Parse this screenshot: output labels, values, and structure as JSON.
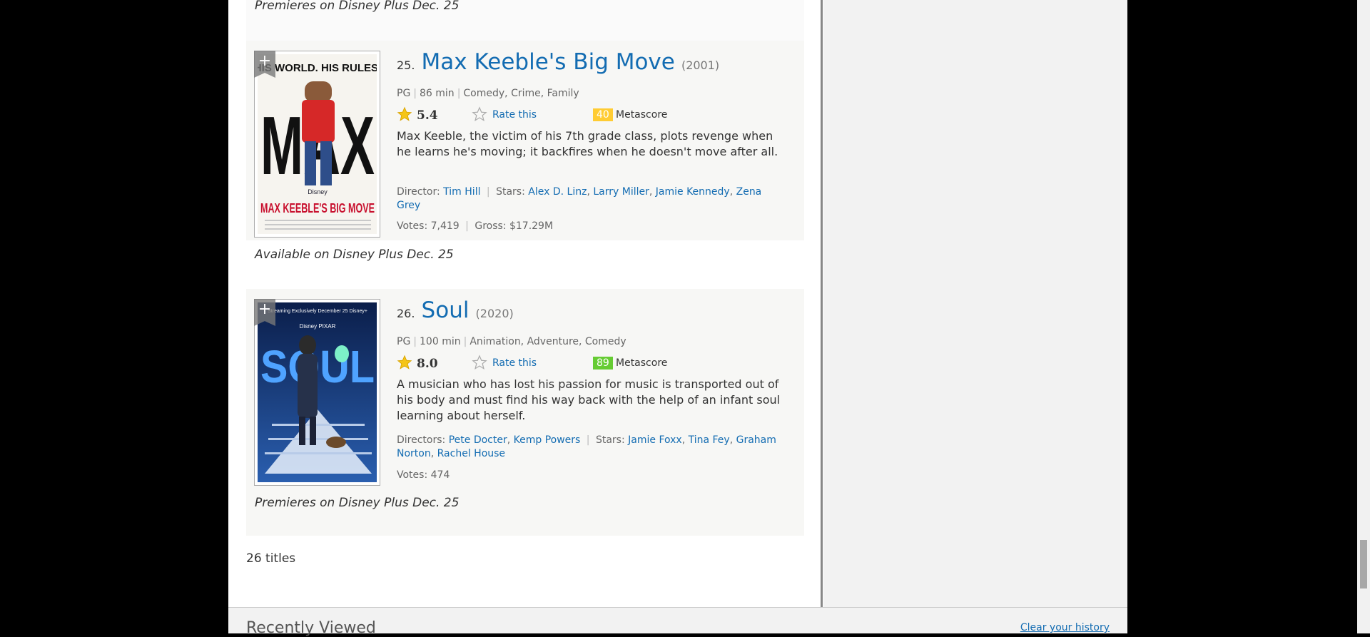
{
  "previous_item": {
    "note": "Premieres on Disney Plus Dec. 25"
  },
  "items": [
    {
      "index": "25.",
      "title": "Max Keeble's Big Move",
      "year": "(2001)",
      "certificate": "PG",
      "runtime": "86 min",
      "genres": "Comedy, Crime, Family",
      "rating": "5.4",
      "rate_label": "Rate this",
      "metascore": "40",
      "metascore_color": "#ffcc33",
      "metascore_label": "Metascore",
      "description": "Max Keeble, the victim of his 7th grade class, plots revenge when he learns he's moving; it backfires when he doesn't move after all.",
      "director_label": "Director:",
      "directors": [
        "Tim Hill"
      ],
      "stars_label": "Stars:",
      "stars": [
        "Alex D. Linz",
        "Larry Miller",
        "Jamie Kennedy",
        "Zena Grey"
      ],
      "votes_label": "Votes:",
      "votes": "7,419",
      "gross_label": "Gross:",
      "gross": "$17.29M",
      "note": "Available on Disney Plus Dec. 25",
      "poster": {
        "tagline": "HIS WORLD. HIS RULES.",
        "big_text": "MAX",
        "title_text": "MAX KEEBLE'S BIG MOVE",
        "studio": "Disney"
      }
    },
    {
      "index": "26.",
      "title": "Soul",
      "year": "(2020)",
      "certificate": "PG",
      "runtime": "100 min",
      "genres": "Animation, Adventure, Comedy",
      "rating": "8.0",
      "rate_label": "Rate this",
      "metascore": "89",
      "metascore_color": "#66cc33",
      "metascore_label": "Metascore",
      "description": "A musician who has lost his passion for music is transported out of his body and must find his way back with the help of an infant soul learning about herself.",
      "director_label": "Directors:",
      "directors": [
        "Pete Docter",
        "Kemp Powers"
      ],
      "stars_label": "Stars:",
      "stars": [
        "Jamie Foxx",
        "Tina Fey",
        "Graham Norton",
        "Rachel House"
      ],
      "votes_label": "Votes:",
      "votes": "474",
      "note": "Premieres on Disney Plus Dec. 25",
      "poster": {
        "tagline": "Streaming Exclusively December 25 Disney+",
        "big_text": "SOUL",
        "studio": "Disney PIXAR"
      }
    }
  ],
  "total": "26 titles",
  "recently_viewed": {
    "title": "Recently Viewed",
    "clear_label": "Clear your history"
  },
  "colors": {
    "link": "#136cb2",
    "star": "#f5c518"
  }
}
